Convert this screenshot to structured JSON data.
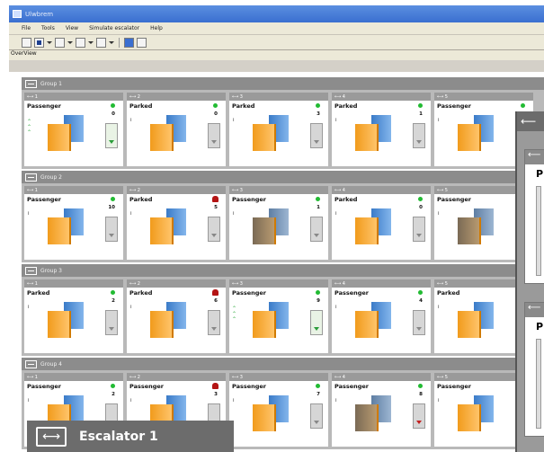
{
  "window": {
    "title": "Ulwbrem"
  },
  "menu": [
    "File",
    "Tools",
    "View",
    "Simulate escalator",
    "Help"
  ],
  "view_label": "OverView",
  "groups": [
    {
      "title": "Group 1",
      "cards": [
        {
          "id": "1",
          "state": "Passenger",
          "count": "0",
          "led": "green",
          "direction": "up",
          "gauge": "green",
          "fault": false
        },
        {
          "id": "2",
          "state": "Parked",
          "count": "0",
          "led": "green",
          "direction": "",
          "gauge": "grey",
          "fault": false
        },
        {
          "id": "3",
          "state": "Parked",
          "count": "3",
          "led": "green",
          "direction": "",
          "gauge": "grey",
          "fault": false
        },
        {
          "id": "4",
          "state": "Parked",
          "count": "1",
          "led": "green",
          "direction": "",
          "gauge": "grey",
          "fault": false
        },
        {
          "id": "5",
          "state": "Passenger",
          "count": "",
          "led": "green",
          "direction": "",
          "gauge": "",
          "fault": false
        }
      ]
    },
    {
      "title": "Group 2",
      "cards": [
        {
          "id": "1",
          "state": "Passenger",
          "count": "10",
          "led": "green",
          "direction": "",
          "gauge": "grey",
          "fault": false
        },
        {
          "id": "2",
          "state": "Parked",
          "count": "5",
          "led": "alarm",
          "direction": "",
          "gauge": "grey",
          "fault": false
        },
        {
          "id": "3",
          "state": "Passenger",
          "count": "1",
          "led": "green",
          "direction": "",
          "gauge": "grey",
          "fault": true
        },
        {
          "id": "4",
          "state": "Parked",
          "count": "0",
          "led": "green",
          "direction": "",
          "gauge": "grey",
          "fault": false
        },
        {
          "id": "5",
          "state": "Passenger",
          "count": "",
          "led": "",
          "direction": "",
          "gauge": "",
          "fault": true
        }
      ]
    },
    {
      "title": "Group 3",
      "cards": [
        {
          "id": "1",
          "state": "Parked",
          "count": "2",
          "led": "green",
          "direction": "",
          "gauge": "grey",
          "fault": false
        },
        {
          "id": "2",
          "state": "Parked",
          "count": "6",
          "led": "alarm",
          "direction": "",
          "gauge": "grey",
          "fault": false
        },
        {
          "id": "3",
          "state": "Passenger",
          "count": "9",
          "led": "green",
          "direction": "up",
          "gauge": "green",
          "fault": false
        },
        {
          "id": "4",
          "state": "Passenger",
          "count": "4",
          "led": "green",
          "direction": "",
          "gauge": "grey",
          "fault": false
        },
        {
          "id": "5",
          "state": "Parked",
          "count": "",
          "led": "green",
          "direction": "",
          "gauge": "",
          "fault": false
        }
      ]
    },
    {
      "title": "Group 4",
      "cards": [
        {
          "id": "1",
          "state": "Passenger",
          "count": "2",
          "led": "green",
          "direction": "",
          "gauge": "grey",
          "fault": false
        },
        {
          "id": "2",
          "state": "Passenger",
          "count": "3",
          "led": "alarm",
          "direction": "",
          "gauge": "grey",
          "fault": false
        },
        {
          "id": "3",
          "state": "Passenger",
          "count": "7",
          "led": "green",
          "direction": "",
          "gauge": "grey",
          "fault": false
        },
        {
          "id": "4",
          "state": "Passenger",
          "count": "8",
          "led": "green",
          "direction": "",
          "gauge": "red",
          "fault": true
        },
        {
          "id": "5",
          "state": "Passenger",
          "count": "",
          "led": "green",
          "direction": "",
          "gauge": "",
          "fault": false
        }
      ]
    }
  ],
  "overlay": {
    "state_letter": "P"
  },
  "escalator_panel": {
    "title": "Escalator 1"
  },
  "colors": {
    "accent_orange": "#f19b1c",
    "accent_blue": "#3a7bc8",
    "led_green": "#22bb33",
    "alarm_red": "#b41414"
  }
}
